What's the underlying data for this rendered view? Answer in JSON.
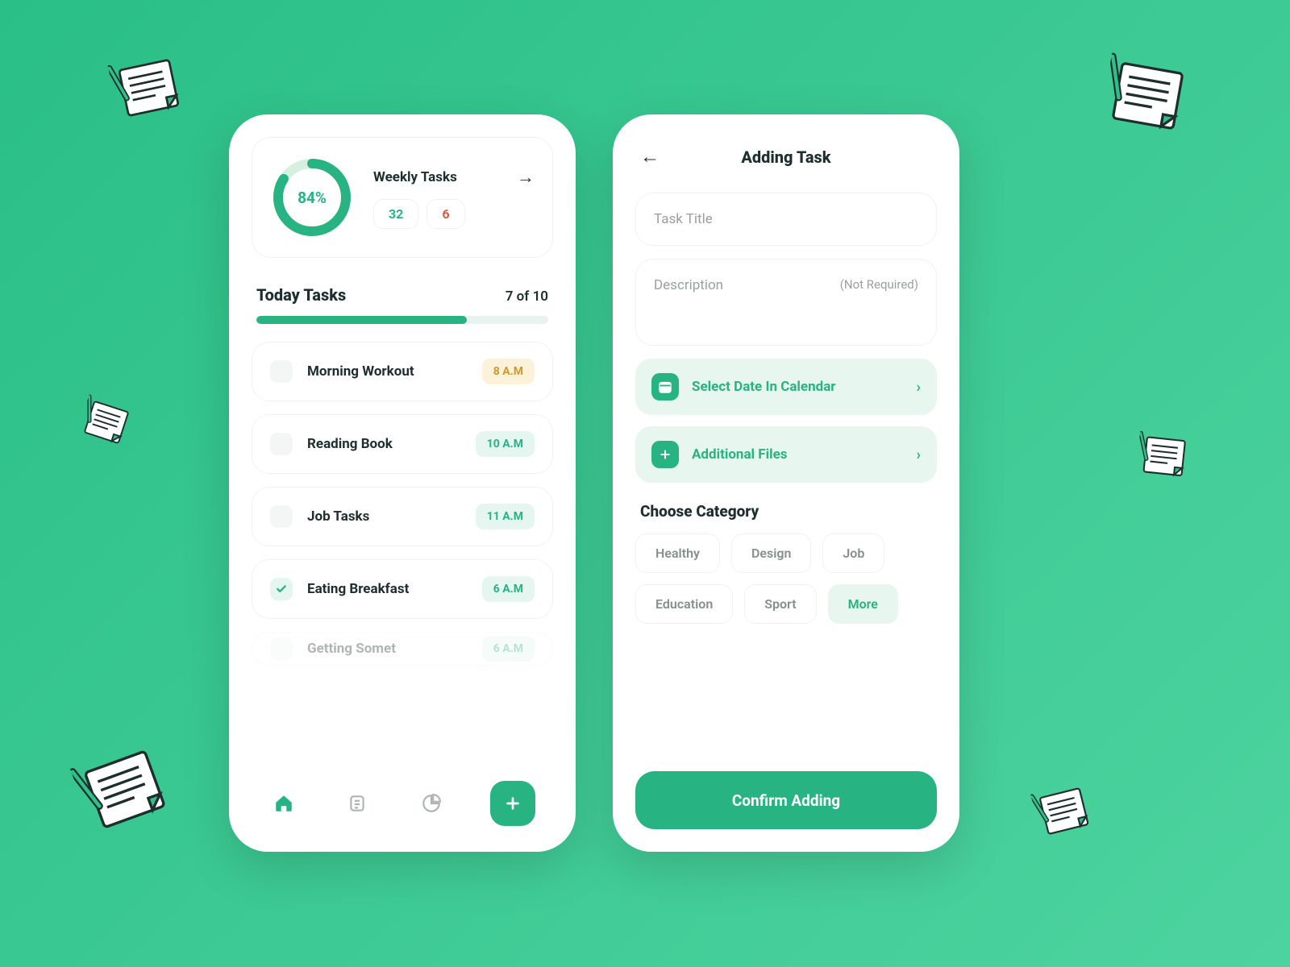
{
  "left": {
    "weekly": {
      "percent_label": "84%",
      "percent_value": 84,
      "title": "Weekly Tasks",
      "done": "32",
      "remain": "6"
    },
    "today": {
      "title": "Today Tasks",
      "count": "7 of 10",
      "progress_percent": 72
    },
    "tasks": [
      {
        "name": "Morning Workout",
        "time": "8 A.M",
        "checked": false,
        "pill": "yellow"
      },
      {
        "name": "Reading Book",
        "time": "10 A.M",
        "checked": false,
        "pill": "green"
      },
      {
        "name": "Job Tasks",
        "time": "11 A.M",
        "checked": false,
        "pill": "green"
      },
      {
        "name": "Eating Breakfast",
        "time": "6 A.M",
        "checked": true,
        "pill": "green"
      },
      {
        "name": "Getting Somet",
        "time": "6 A.M",
        "checked": false,
        "pill": "green"
      }
    ]
  },
  "right": {
    "page_title": "Adding Task",
    "title_placeholder": "Task Title",
    "desc_placeholder": "Description",
    "desc_hint": "(Not Required)",
    "actions": {
      "date": "Select Date In Calendar",
      "files": "Additional Files"
    },
    "category_title": "Choose Category",
    "categories": [
      "Healthy",
      "Design",
      "Job",
      "Education",
      "Sport",
      "More"
    ],
    "confirm": "Confirm Adding"
  },
  "colors": {
    "accent": "#28b383"
  }
}
